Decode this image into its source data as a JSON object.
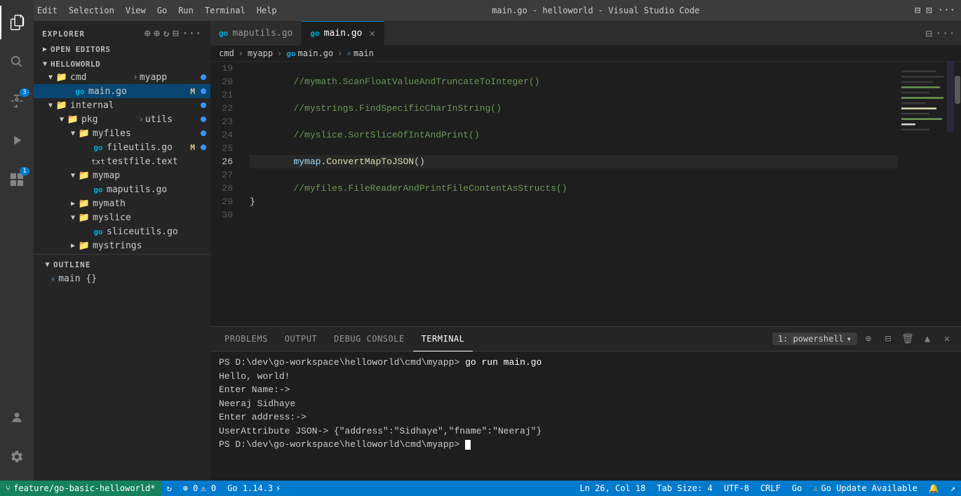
{
  "app": {
    "title": "EXPLORER",
    "window_title": "main.go - helloworld - Visual Studio Code"
  },
  "activity_bar": {
    "icons": [
      {
        "name": "explorer-icon",
        "symbol": "⎘",
        "active": true,
        "badge": null
      },
      {
        "name": "search-icon",
        "symbol": "🔍",
        "active": false,
        "badge": null
      },
      {
        "name": "source-control-icon",
        "symbol": "⑂",
        "active": false,
        "badge": "3"
      },
      {
        "name": "run-icon",
        "symbol": "▷",
        "active": false,
        "badge": null
      },
      {
        "name": "extensions-icon",
        "symbol": "⊞",
        "active": false,
        "badge": "1"
      }
    ],
    "bottom_icons": [
      {
        "name": "account-icon",
        "symbol": "👤"
      },
      {
        "name": "settings-icon",
        "symbol": "⚙"
      }
    ]
  },
  "sidebar": {
    "header": "EXPLORER",
    "sections": {
      "open_editors": {
        "label": "OPEN EDITORS",
        "collapsed": false
      },
      "helloworld": {
        "label": "HELLOWORLD",
        "items": [
          {
            "id": "cmd-myapp",
            "label": "cmd > myapp",
            "indent": 1,
            "type": "folder",
            "arrow": "▼",
            "dot": true
          },
          {
            "id": "main-go",
            "label": "main.go",
            "indent": 2,
            "type": "go-file",
            "arrow": "",
            "dot": true,
            "badge": "M",
            "active": true
          },
          {
            "id": "internal",
            "label": "internal",
            "indent": 1,
            "type": "folder",
            "arrow": "▼",
            "dot": true
          },
          {
            "id": "pkg-utils",
            "label": "pkg > utils",
            "indent": 2,
            "type": "folder",
            "arrow": "▼",
            "dot": true
          },
          {
            "id": "myfiles",
            "label": "myfiles",
            "indent": 3,
            "type": "folder",
            "arrow": "▼",
            "dot": true
          },
          {
            "id": "fileutils-go",
            "label": "fileutils.go",
            "indent": 4,
            "type": "go-file",
            "arrow": "",
            "dot": true,
            "badge": "M"
          },
          {
            "id": "testfile-txt",
            "label": "testfile.text",
            "indent": 4,
            "type": "txt-file",
            "arrow": "",
            "dot": false
          },
          {
            "id": "mymap",
            "label": "mymap",
            "indent": 3,
            "type": "folder",
            "arrow": "▼",
            "dot": false
          },
          {
            "id": "maputils-go",
            "label": "maputils.go",
            "indent": 4,
            "type": "go-file",
            "arrow": "",
            "dot": false
          },
          {
            "id": "mymath",
            "label": "mymath",
            "indent": 3,
            "type": "folder",
            "arrow": "▶",
            "dot": false
          },
          {
            "id": "myslice",
            "label": "myslice",
            "indent": 3,
            "type": "folder",
            "arrow": "▼",
            "dot": false
          },
          {
            "id": "sliceutils-go",
            "label": "sliceutils.go",
            "indent": 4,
            "type": "go-file",
            "arrow": "",
            "dot": false
          },
          {
            "id": "mystrings",
            "label": "mystrings",
            "indent": 3,
            "type": "folder",
            "arrow": "▶",
            "dot": false
          }
        ]
      },
      "outline": {
        "label": "OUTLINE",
        "items": [
          {
            "id": "main-func",
            "label": "main  {}",
            "indent": 1,
            "type": "func"
          }
        ]
      }
    }
  },
  "tabs": [
    {
      "id": "maputils",
      "label": "maputils.go",
      "active": false,
      "modified": false,
      "icon": "go"
    },
    {
      "id": "maingo",
      "label": "main.go",
      "active": true,
      "modified": false,
      "icon": "go"
    }
  ],
  "breadcrumb": {
    "items": [
      "cmd",
      "myapp",
      "main.go",
      "main"
    ]
  },
  "editor": {
    "language": "go",
    "lines": [
      {
        "num": 19,
        "tokens": [
          {
            "text": "",
            "class": ""
          }
        ]
      },
      {
        "num": 20,
        "tokens": [
          {
            "text": "\t//mymath.ScanFloatValueAndTruncateToInteger()",
            "class": "c-comment"
          }
        ]
      },
      {
        "num": 21,
        "tokens": [
          {
            "text": "",
            "class": ""
          }
        ]
      },
      {
        "num": 22,
        "tokens": [
          {
            "text": "\t//mystrings.FindSpecificCharInString()",
            "class": "c-comment"
          }
        ]
      },
      {
        "num": 23,
        "tokens": [
          {
            "text": "",
            "class": ""
          }
        ]
      },
      {
        "num": 24,
        "tokens": [
          {
            "text": "\t//myslice.SortSliceOfIntAndPrint()",
            "class": "c-comment"
          }
        ]
      },
      {
        "num": 25,
        "tokens": [
          {
            "text": "",
            "class": ""
          }
        ]
      },
      {
        "num": 26,
        "tokens": [
          {
            "text": "\t",
            "class": ""
          },
          {
            "text": "mymap",
            "class": "c-var"
          },
          {
            "text": ".",
            "class": "c-punct"
          },
          {
            "text": "ConvertMapToJSON",
            "class": "c-func"
          },
          {
            "text": "()",
            "class": "c-punct"
          }
        ],
        "current": true
      },
      {
        "num": 27,
        "tokens": [
          {
            "text": "",
            "class": ""
          }
        ]
      },
      {
        "num": 28,
        "tokens": [
          {
            "text": "\t//myfiles.FileReaderAndPrintFileContentAsStructs()",
            "class": "c-comment"
          }
        ]
      },
      {
        "num": 29,
        "tokens": [
          {
            "text": "}",
            "class": "c-punct"
          }
        ]
      },
      {
        "num": 30,
        "tokens": [
          {
            "text": "",
            "class": ""
          }
        ]
      }
    ]
  },
  "terminal": {
    "tabs": [
      {
        "id": "problems",
        "label": "PROBLEMS",
        "active": false
      },
      {
        "id": "output",
        "label": "OUTPUT",
        "active": false
      },
      {
        "id": "debug-console",
        "label": "DEBUG CONSOLE",
        "active": false
      },
      {
        "id": "terminal",
        "label": "TERMINAL",
        "active": true
      }
    ],
    "active_shell": "1: powershell",
    "lines": [
      {
        "type": "prompt",
        "text": "PS D:\\dev\\go-workspace\\helloworld\\cmd\\myapp> ",
        "cmd": "go run main.go"
      },
      {
        "type": "output",
        "text": "Hello, world!"
      },
      {
        "type": "output",
        "text": "Enter Name:->"
      },
      {
        "type": "output",
        "text": "Neeraj Sidhaye"
      },
      {
        "type": "output",
        "text": "Enter address:->"
      },
      {
        "type": "output",
        "text": "UserAttribute JSON->  {\"address\":\"Sidhaye\",\"fname\":\"Neeraj\"}"
      },
      {
        "type": "prompt",
        "text": "PS D:\\dev\\go-workspace\\helloworld\\cmd\\myapp> ",
        "cmd": "",
        "cursor": true
      }
    ]
  },
  "status_bar": {
    "left_items": [
      {
        "id": "branch",
        "icon": "⑂",
        "text": "feature/go-basic-helloworld*",
        "dark": true
      },
      {
        "id": "sync",
        "icon": "↻",
        "text": ""
      }
    ],
    "right_items": [
      {
        "id": "errors",
        "text": "⊗ 0  ⚠ 0"
      },
      {
        "id": "go-version",
        "text": "Go 1.14.3"
      },
      {
        "id": "position",
        "text": "Ln 26, Col 18"
      },
      {
        "id": "tab-size",
        "text": "Tab Size: 4"
      },
      {
        "id": "encoding",
        "text": "UTF-8"
      },
      {
        "id": "line-ending",
        "text": "CRLF"
      },
      {
        "id": "language",
        "text": "Go"
      },
      {
        "id": "go-update",
        "icon": "⚠",
        "text": "Go Update Available"
      },
      {
        "id": "notifications",
        "icon": "🔔",
        "text": ""
      },
      {
        "id": "remote",
        "icon": "↗",
        "text": ""
      }
    ]
  }
}
